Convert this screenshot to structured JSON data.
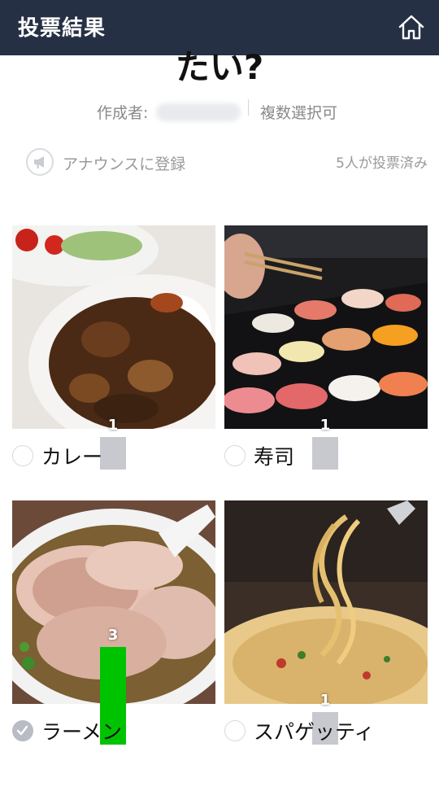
{
  "header": {
    "title": "投票結果",
    "home_icon": "home-icon"
  },
  "poll": {
    "question_tail": "たい?",
    "author_label": "作成者:",
    "multi_select_label": "複数選択可",
    "announce_label": "アナウンスに登録",
    "announce_icon": "megaphone-icon",
    "voted_label": "5人が投票済み",
    "max_votes": 3
  },
  "options": [
    {
      "label": "カレー",
      "votes": 1,
      "bar_fraction": 0.333,
      "selected": false,
      "bar_color": "#c8c9cf"
    },
    {
      "label": "寿司",
      "votes": 1,
      "bar_fraction": 0.333,
      "selected": false,
      "bar_color": "#c8c9cf"
    },
    {
      "label": "ラーメン",
      "votes": 3,
      "bar_fraction": 1.0,
      "selected": true,
      "bar_color": "#00c300"
    },
    {
      "label": "スパゲッティ",
      "votes": 1,
      "bar_fraction": 0.333,
      "selected": false,
      "bar_color": "#c8c9cf"
    }
  ],
  "colors": {
    "header_bg": "#263045",
    "winner_bar": "#00c300",
    "normal_bar": "#c8c9cf"
  }
}
